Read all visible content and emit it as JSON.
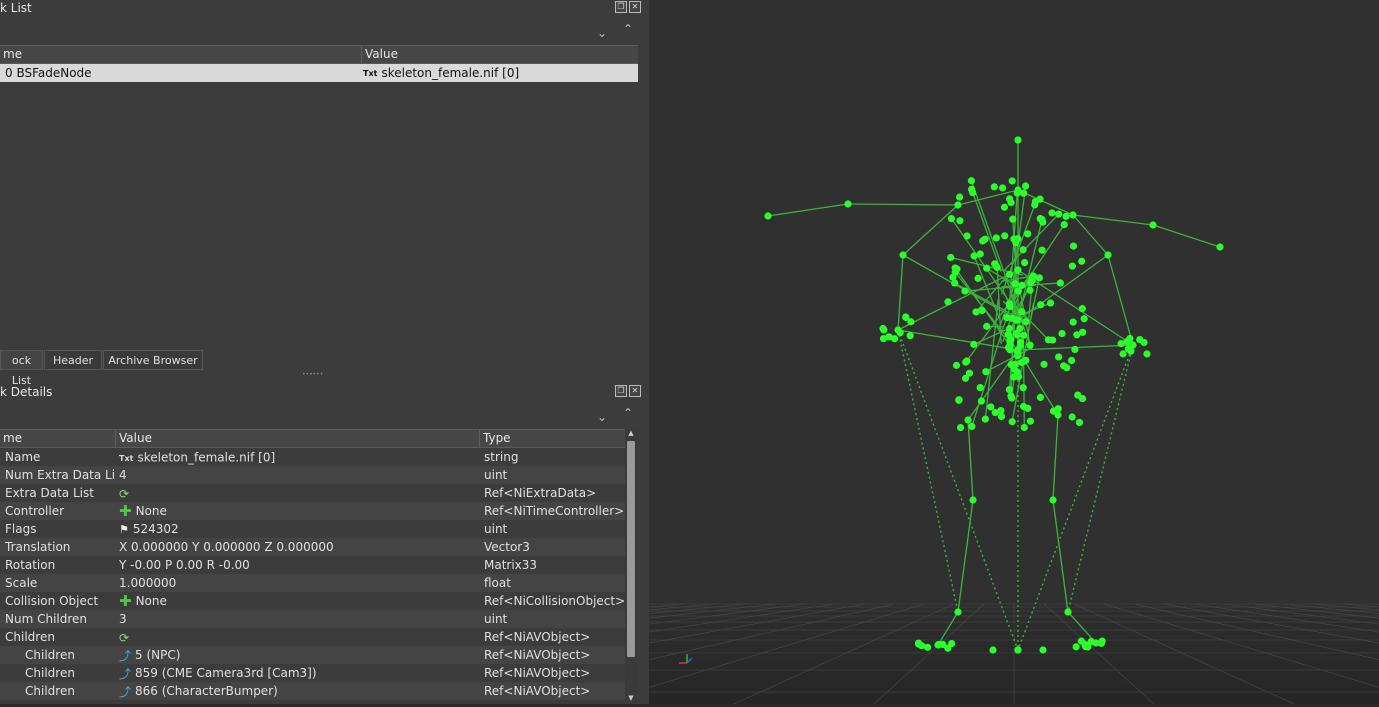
{
  "block_list": {
    "title": "k List",
    "columns": [
      "me",
      "Value"
    ],
    "rows": [
      {
        "name": "0 BSFadeNode",
        "icon": "txt-icon",
        "value": "skeleton_female.nif [0]"
      }
    ]
  },
  "tabs": [
    {
      "label": "ock List"
    },
    {
      "label": "Header"
    },
    {
      "label": "Archive Browser"
    }
  ],
  "splitter": "••••••",
  "block_details": {
    "title": "k Details",
    "columns": [
      "me",
      "Value",
      "Type"
    ],
    "rows": [
      {
        "name": "Name",
        "icon": "txt-icon",
        "value": "skeleton_female.nif [0]",
        "type": "string"
      },
      {
        "name": "Num Extra Data List",
        "icon": "",
        "value": "4",
        "type": "uint"
      },
      {
        "name": "Extra Data List",
        "icon": "array-icon",
        "value": "",
        "type": "Ref<NiExtraData>"
      },
      {
        "name": "Controller",
        "icon": "plus-icon",
        "value": "None",
        "type": "Ref<NiTimeController>"
      },
      {
        "name": "Flags",
        "icon": "flag-icon",
        "value": "524302",
        "type": "uint"
      },
      {
        "name": "Translation",
        "icon": "",
        "value": "X 0.000000 Y 0.000000 Z 0.000000",
        "type": "Vector3"
      },
      {
        "name": "Rotation",
        "icon": "",
        "value": "Y -0.00 P 0.00 R -0.00",
        "type": "Matrix33"
      },
      {
        "name": "Scale",
        "icon": "",
        "value": "1.000000",
        "type": "float"
      },
      {
        "name": "Collision Object",
        "icon": "plus-icon",
        "value": "None",
        "type": "Ref<NiCollisionObject>"
      },
      {
        "name": "Num Children",
        "icon": "",
        "value": "3",
        "type": "uint"
      },
      {
        "name": "Children",
        "icon": "array-icon",
        "value": "",
        "type": "Ref<NiAVObject>"
      },
      {
        "name": "Children",
        "icon": "link-icon",
        "value": "5 (NPC)",
        "type": "Ref<NiAVObject>",
        "indent": true
      },
      {
        "name": "Children",
        "icon": "link-icon",
        "value": "859 (CME Camera3rd [Cam3])",
        "type": "Ref<NiAVObject>",
        "indent": true
      },
      {
        "name": "Children",
        "icon": "link-icon",
        "value": "866 (CharacterBumper)",
        "type": "Ref<NiAVObject>",
        "indent": true
      }
    ]
  },
  "colors": {
    "bone": "#2bff2b",
    "bone_line": "#3cb43c"
  }
}
